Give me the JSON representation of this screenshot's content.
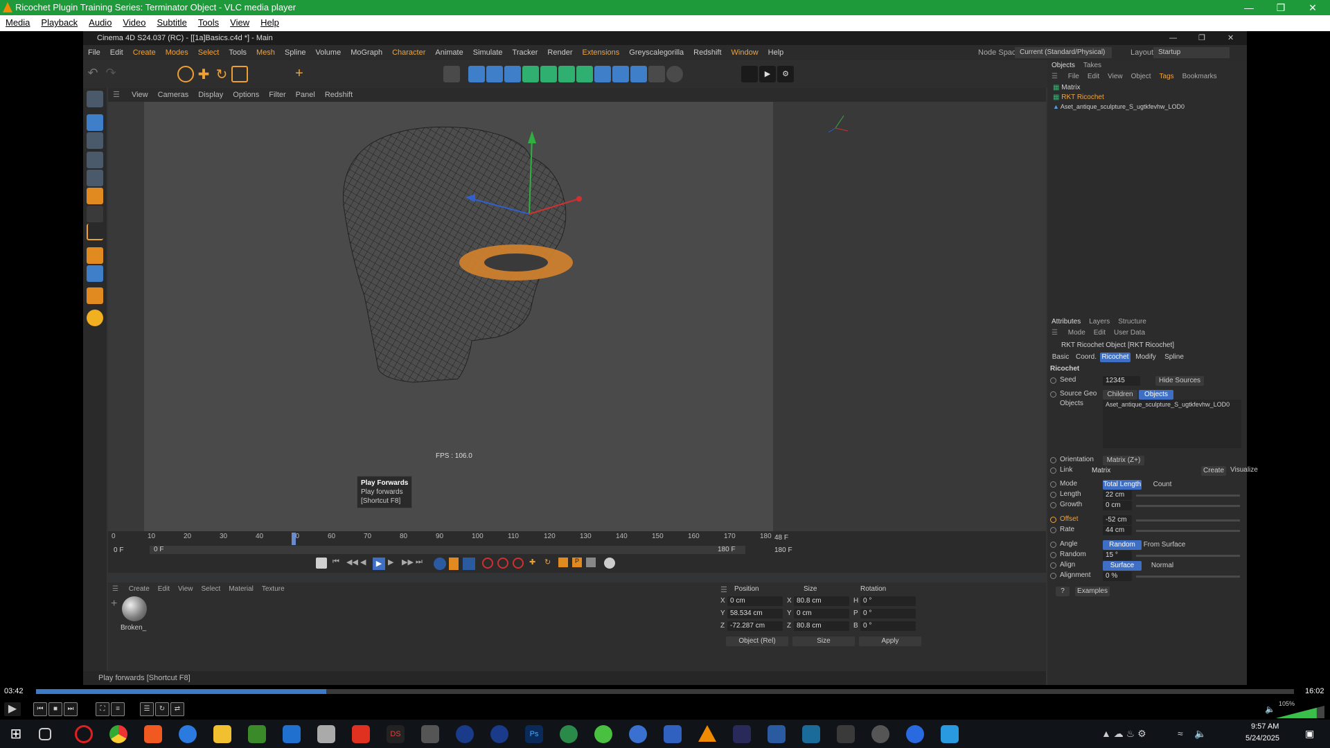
{
  "vlc": {
    "title": "Ricochet Plugin Training Series: Terminator Object - VLC media player",
    "menu": [
      "Media",
      "Playback",
      "Audio",
      "Video",
      "Subtitle",
      "Tools",
      "View",
      "Help"
    ],
    "time_elapsed": "03:42",
    "time_total": "16:02",
    "volume": "105%",
    "progress": 0.231
  },
  "c4d": {
    "title": "Cinema 4D S24.037 (RC) - [[1a]Basics.c4d *] - Main",
    "menu": [
      "File",
      "Edit",
      "Create",
      "Modes",
      "Select",
      "Tools",
      "Mesh",
      "Spline",
      "Volume",
      "MoGraph",
      "Character",
      "Animate",
      "Simulate",
      "Tracker",
      "Render",
      "Extensions",
      "Greyscalegorilla",
      "Redshift",
      "Window",
      "Help"
    ],
    "node_space_label": "Node Space:",
    "node_space_value": "Current (Standard/Physical)",
    "layout_label": "Layout:",
    "layout_value": "Startup",
    "viewport_menu": [
      "View",
      "Cameras",
      "Display",
      "Options",
      "Filter",
      "Panel",
      "Redshift"
    ],
    "fps": "FPS : 106.0",
    "timeline": {
      "ticks": [
        "0",
        "10",
        "20",
        "30",
        "40",
        "50",
        "60",
        "70",
        "80",
        "90",
        "100",
        "110",
        "120",
        "130",
        "140",
        "150",
        "160",
        "170",
        "180"
      ],
      "current_frame": "48 F",
      "start": "0 F",
      "start2": "0 F",
      "end": "180 F",
      "end2": "180 F"
    },
    "tooltip": {
      "title": "Play Forwards",
      "desc": "Play forwards",
      "shortcut": "[Shortcut F8]"
    },
    "materials": {
      "menu": [
        "Create",
        "Edit",
        "View",
        "Select",
        "Material",
        "Texture"
      ],
      "item": "Broken_"
    },
    "coords": {
      "headers": [
        "Position",
        "Size",
        "Rotation"
      ],
      "rows": [
        {
          "axis": "X",
          "pos": "0 cm",
          "saxis": "X",
          "size": "80.8 cm",
          "raxis": "H",
          "rot": "0 °"
        },
        {
          "axis": "Y",
          "pos": "58.534 cm",
          "saxis": "Y",
          "size": "0 cm",
          "raxis": "P",
          "rot": "0 °"
        },
        {
          "axis": "Z",
          "pos": "-72.287 cm",
          "saxis": "Z",
          "size": "80.8 cm",
          "raxis": "B",
          "rot": "0 °"
        }
      ],
      "mode": "Object (Rel)",
      "size_mode": "Size",
      "apply": "Apply"
    },
    "status": "Play forwards [Shortcut F8]",
    "objects": {
      "tabs": [
        "Objects",
        "Takes"
      ],
      "menu": [
        "File",
        "Edit",
        "View",
        "Object",
        "Tags",
        "Bookmarks"
      ],
      "items": [
        "Matrix",
        "RKT Ricochet",
        "Aset_antique_sculpture_S_ugtkfevhw_LOD0"
      ]
    },
    "attributes": {
      "tabs": [
        "Attributes",
        "Layers",
        "Structure"
      ],
      "menu": [
        "Mode",
        "Edit",
        "User Data"
      ],
      "object_title": "RKT Ricochet Object [RKT Ricochet]",
      "subtabs": [
        "Basic",
        "Coord.",
        "Ricochet",
        "Modify",
        "Spline"
      ],
      "section": "Ricochet",
      "seed_label": "Seed",
      "seed": "12345",
      "hide_sources": "Hide Sources",
      "source_geo_label": "Source Geo",
      "children": "Children",
      "objects_btn": "Objects",
      "objects_label": "Objects",
      "objects_value": "Aset_antique_sculpture_S_ugtkfevhw_LOD0",
      "orientation_label": "Orientation",
      "orientation": "Matrix (Z+)",
      "link_label": "Link",
      "link": "Matrix",
      "create": "Create",
      "visualize": "Visualize",
      "mode_label": "Mode",
      "total_length": "Total Length",
      "count": "Count",
      "length_label": "Length",
      "length": "22 cm",
      "growth_label": "Growth",
      "growth": "0 cm",
      "offset_label": "Offset",
      "offset": "-52 cm",
      "rate_label": "Rate",
      "rate": "44 cm",
      "angle_label": "Angle",
      "random_btn": "Random",
      "from_surface": "From Surface",
      "random_label": "Random",
      "random": "15 °",
      "align_label": "Align",
      "surface": "Surface",
      "normal": "Normal",
      "alignment_label": "Alignment",
      "alignment": "0 %",
      "help": "?",
      "examples": "Examples"
    }
  },
  "taskbar": {
    "time": "9:57 AM",
    "date": "5/24/2025"
  }
}
